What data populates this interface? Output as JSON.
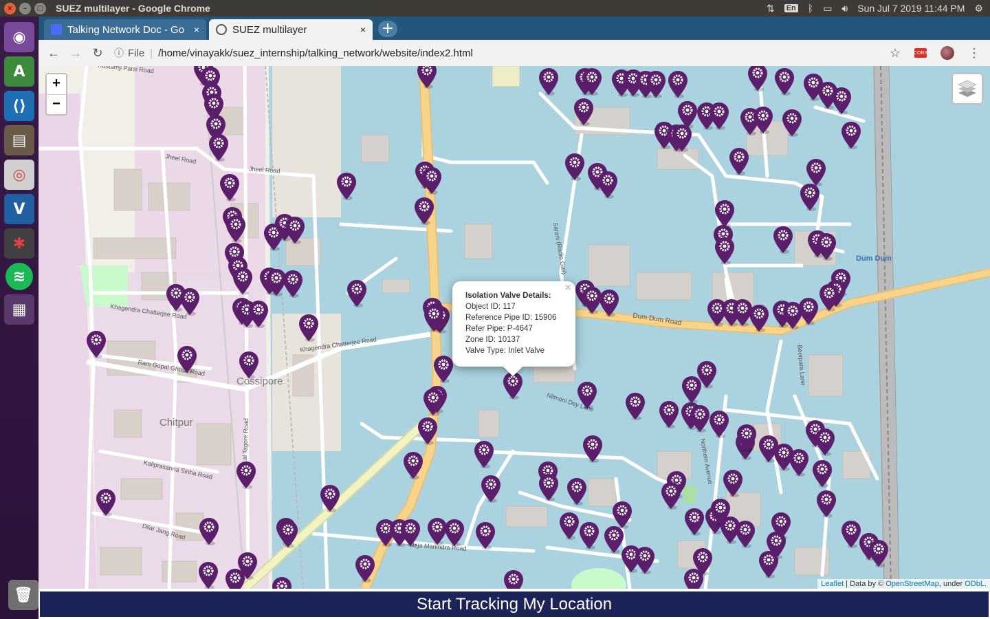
{
  "system": {
    "window_title": "SUEZ multilayer - Google Chrome",
    "keyboard_layout": "En",
    "datetime": "Sun Jul  7 2019 11:44 PM"
  },
  "launcher": {
    "apps": [
      "ubuntu-dash",
      "android-studio",
      "vscode",
      "files",
      "chrome",
      "virtualbox",
      "network-tool",
      "spotify",
      "workspace-switcher",
      "trash"
    ]
  },
  "browser": {
    "tabs": [
      {
        "label": "Talking Network Doc - Go",
        "active": false
      },
      {
        "label": "SUEZ multilayer",
        "active": true
      }
    ],
    "url_scheme_label": "File",
    "url": "/home/vinayakk/suez_internship/talking_network/website/index2.html"
  },
  "map": {
    "zoom_in": "+",
    "zoom_out": "−",
    "place_labels": {
      "cossipore": "Cossipore",
      "chitpur": "Chitpur",
      "dum_dum": "Dum Dum"
    },
    "road_labels": {
      "dum_dum_road": "Dum Dum Road",
      "khagendra_1": "Khagendra Chatterjee Road",
      "khagendra_2": "Khagendra Chatterjee Road",
      "ram_gopal": "Ram Gopal Ghosh Road",
      "kaliprasanna": "Kaliprasanna Sinha Road",
      "dilar_jang": "Dilar Jang Road",
      "nilmoni": "Nilmoni Dey Lane",
      "raja_manindra": "Raja Manindra Road",
      "jheel_1": "Jheel Road",
      "jheel_2": "Jheel Road",
      "parsi": "Rustamji Parsi Road",
      "northern_ave": "Northern Avenue",
      "beerpara": "Beerpara Lane",
      "lal_tagore": "Lal Tagore Road",
      "radio_gali": "Sarani (Radio Gali)"
    },
    "popup": {
      "title": "Isolation Valve Details:",
      "object_id": "Object ID: 117",
      "reference_pipe_id": "Reference Pipe ID: 15906",
      "refer_pipe": "Refer Pipe: P-4647",
      "zone_id": "Zone ID: 10137",
      "valve_type": "Valve Type: Inlet Valve"
    },
    "marker_color": "#5b1e6a",
    "marker_icon": "gear-icon",
    "attribution": {
      "leaflet": "Leaflet",
      "data_by": " | Data by © ",
      "osm": "OpenStreetMap",
      "under": ", under ",
      "odbl": "ODbL."
    }
  },
  "tracking_button": "Start Tracking My Location"
}
